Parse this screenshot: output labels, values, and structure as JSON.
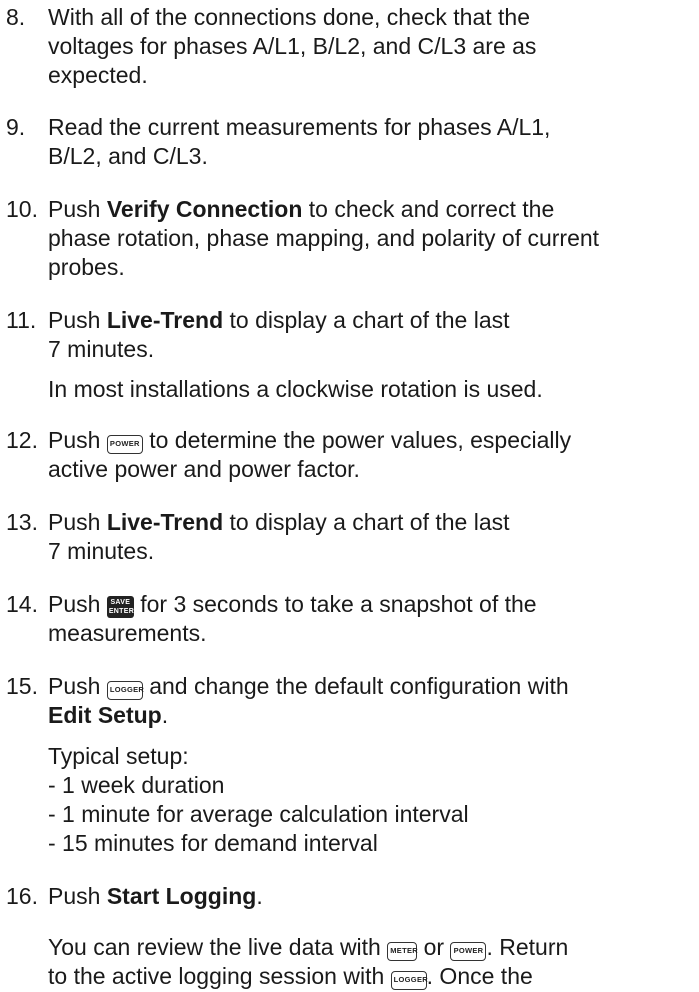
{
  "steps": [
    {
      "num": "8.",
      "lines": [
        "With all of the connections done, check that the",
        "voltages for phases A/L1, B/L2, and C/L3 are as",
        "expected."
      ]
    },
    {
      "num": "9.",
      "lines": [
        "Read the current measurements for phases A/L1,",
        "B/L2, and C/L3."
      ]
    },
    {
      "num": "10.",
      "pre": "Push ",
      "bold": "Verify Connection",
      "post": " to check and correct the",
      "lines": [
        "phase rotation, phase mapping, and polarity of current",
        "probes."
      ]
    },
    {
      "num": "11.",
      "pre": "Push ",
      "bold": "Live-Trend",
      "post": " to display a chart of the last",
      "lines": [
        "7 minutes."
      ],
      "note": "In most installations a clockwise rotation is used."
    },
    {
      "num": "12.",
      "pre": "Push ",
      "key": "POWER",
      "post": " to determine the power values, especially",
      "lines": [
        "active power and power factor."
      ]
    },
    {
      "num": "13.",
      "pre": "Push ",
      "bold": "Live-Trend",
      "post": " to display a chart of the last",
      "lines": [
        "7 minutes."
      ]
    },
    {
      "num": "14.",
      "pre": "Push ",
      "key_top": "SAVE",
      "key_bottom": "ENTER",
      "post": " for 3 seconds to take a snapshot of the",
      "lines": [
        "measurements."
      ]
    },
    {
      "num": "15.",
      "pre": "Push ",
      "key": "LOGGER",
      "post": " and change the default configuration with",
      "bold2": "Edit Setup",
      "post2": ".",
      "setup_title": "Typical setup:",
      "setup_items": [
        "- 1 week duration",
        "- 1 minute for average calculation interval",
        "- 15 minutes for demand interval"
      ]
    },
    {
      "num": "16.",
      "pre": "Push ",
      "bold": "Start Logging",
      "post": ".",
      "note_pre": "You can review the live data with ",
      "note_key1": "METER",
      "note_mid": " or ",
      "note_key2": "POWER",
      "note_post": ". Return",
      "note2_pre": "to the active logging session with ",
      "note2_key": "LOGGER",
      "note2_post": ". Once the"
    }
  ]
}
